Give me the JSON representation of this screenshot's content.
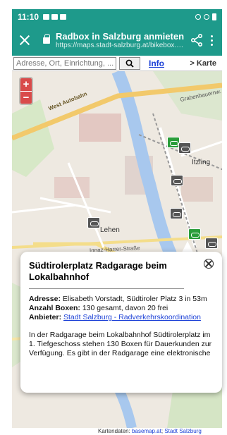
{
  "status": {
    "time": "11:10"
  },
  "header": {
    "title": "Radbox in Salzburg anmieten",
    "url": "https://maps.stadt-salzburg.at/bikebox.html#..."
  },
  "search": {
    "placeholder": "Adresse, Ort, Einrichtung, ...",
    "info_label": "Info",
    "karte_label": "> Karte"
  },
  "zoom": {
    "plus": "+",
    "minus": "−"
  },
  "map_labels": {
    "west_autobahn": "West Autobahn",
    "itzling": "Itzling",
    "lehen": "Lehen",
    "ignaz_harrer": "Ignaz-Harrer-Straße",
    "grabenbauernw": "Grabenbauernw."
  },
  "popup": {
    "title": "Südtirolerplatz Radgarage beim Lokalbahnhof",
    "adresse_label": "Adresse:",
    "adresse_value": "Elisabeth Vorstadt, Südtiroler Platz 3 in 53m",
    "boxen_label": "Anzahl Boxen:",
    "boxen_value": "130 gesamt, davon 20 frei",
    "anbieter_label": "Anbieter:",
    "anbieter_value": "Stadt Salzburg - Radverkehrskoordination",
    "description": "In der Radgarage beim Lokalbahnhof Südtirolerplatz im 1. Tiefgeschoss stehen 130 Boxen für Dauerkunden zur Verfügung. Es gibt in der Radgarage eine elektronische"
  },
  "attribution": {
    "prefix": "Kartendaten: ",
    "link1": "basemap.at",
    "sep": "; ",
    "link2": "Stadt Salzburg"
  },
  "colors": {
    "header": "#1e9a8b",
    "zoom": "#d94a4a",
    "link": "#1a3fd6"
  }
}
